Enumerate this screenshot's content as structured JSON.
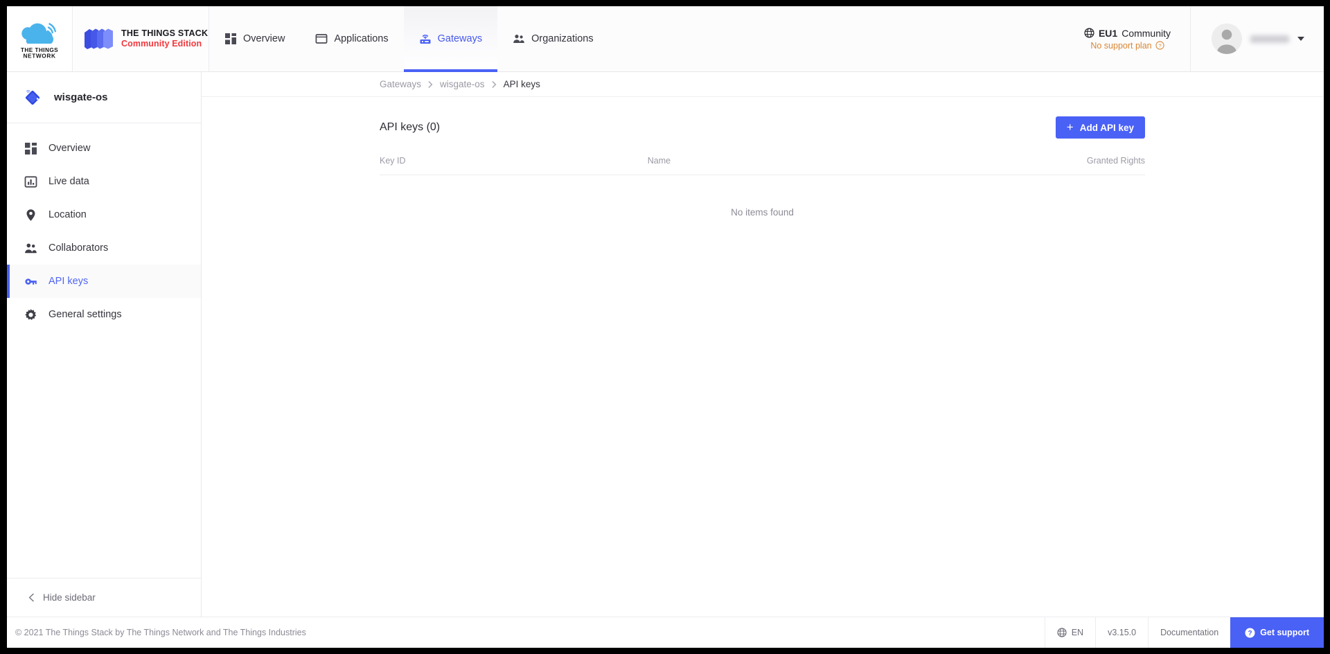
{
  "topbar": {
    "brand_network_line1": "THE THINGS",
    "brand_network_line2": "NETWORK",
    "stack_line1": "THE THINGS STACK",
    "stack_line2": "Community Edition",
    "nav": [
      {
        "label": "Overview",
        "icon": "overview-icon",
        "active": false
      },
      {
        "label": "Applications",
        "icon": "applications-icon",
        "active": false
      },
      {
        "label": "Gateways",
        "icon": "gateway-icon",
        "active": true
      },
      {
        "label": "Organizations",
        "icon": "organizations-icon",
        "active": false
      }
    ],
    "cluster_code": "EU1",
    "cluster_name": "Community",
    "support_plan": "No support plan",
    "user_name": ""
  },
  "sidebar": {
    "entity_title": "wisgate-os",
    "entity_icon": "gateway-diamond-icon",
    "items": [
      {
        "label": "Overview",
        "icon": "overview-icon",
        "active": false
      },
      {
        "label": "Live data",
        "icon": "live-data-icon",
        "active": false
      },
      {
        "label": "Location",
        "icon": "location-pin-icon",
        "active": false
      },
      {
        "label": "Collaborators",
        "icon": "collaborators-icon",
        "active": false
      },
      {
        "label": "API keys",
        "icon": "key-icon",
        "active": true
      },
      {
        "label": "General settings",
        "icon": "gear-icon",
        "active": false
      }
    ],
    "hide_label": "Hide sidebar"
  },
  "breadcrumb": [
    {
      "label": "Gateways",
      "current": false
    },
    {
      "label": "wisgate-os",
      "current": false
    },
    {
      "label": "API keys",
      "current": true
    }
  ],
  "main": {
    "page_title": "API keys (0)",
    "add_button": "Add API key",
    "columns": {
      "key_id": "Key ID",
      "name": "Name",
      "granted_rights": "Granted Rights"
    },
    "empty_message": "No items found"
  },
  "footer": {
    "copyright": "© 2021 The Things Stack by The Things Network and The Things Industries",
    "language": "EN",
    "version": "v3.15.0",
    "documentation": "Documentation",
    "get_support": "Get support"
  },
  "colors": {
    "accent": "#4a61f5",
    "brand_red": "#f1373c",
    "support_plan_orange": "#d98634",
    "muted_text": "#9b9ba6"
  }
}
